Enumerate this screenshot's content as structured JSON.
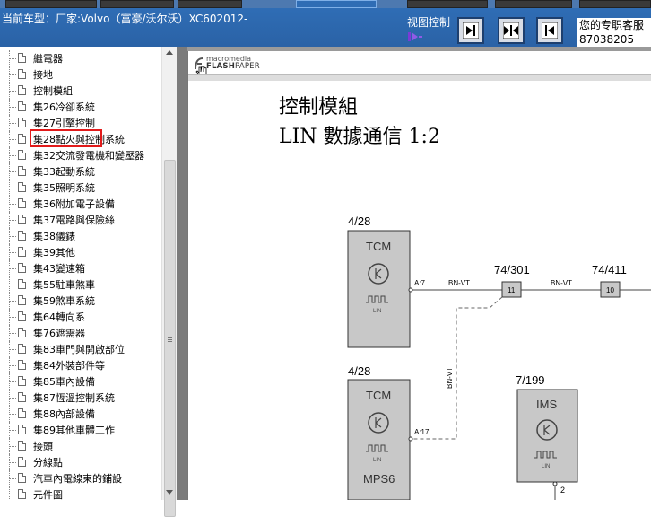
{
  "header": {
    "car_model": "当前车型：厂家:Volvo（富豪/沃尔沃）XC602012-",
    "view_control_label": "视图控制",
    "contact_line1": "您的专职客服",
    "contact_line2": "87038205",
    "controls": [
      "collapse-left-icon",
      "split-view-icon",
      "expand-left-icon"
    ]
  },
  "sidebar": {
    "items": [
      {
        "label": "繼電器"
      },
      {
        "label": "接地"
      },
      {
        "label": "控制模組",
        "selected": true
      },
      {
        "label": "集26冷卻系統"
      },
      {
        "label": "集27引擎控制"
      },
      {
        "label": "集28點火與控制系統"
      },
      {
        "label": "集32交流發電機和變壓器"
      },
      {
        "label": "集33起動系統"
      },
      {
        "label": "集35照明系統"
      },
      {
        "label": "集36附加電子設備"
      },
      {
        "label": "集37電路與保險絲"
      },
      {
        "label": "集38儀錶"
      },
      {
        "label": "集39其他"
      },
      {
        "label": "集43變速箱"
      },
      {
        "label": "集55駐車煞車"
      },
      {
        "label": "集59煞車系統"
      },
      {
        "label": "集64轉向系"
      },
      {
        "label": "集76遮需器"
      },
      {
        "label": "集83車門與開啟部位"
      },
      {
        "label": "集84外裝部件等"
      },
      {
        "label": "集85車內設備"
      },
      {
        "label": "集87恆溫控制系統"
      },
      {
        "label": "集88內部設備"
      },
      {
        "label": "集89其他車體工作"
      },
      {
        "label": "接頭"
      },
      {
        "label": "分線點"
      },
      {
        "label": "汽車內電線束的鋪設"
      },
      {
        "label": "元件圖"
      }
    ]
  },
  "viewer": {
    "logo_top": "macromedia",
    "logo_flash": "FLASH",
    "logo_paper": "PAPER",
    "title": "控制模組",
    "subtitle": "LIN 數據通信 1:2",
    "tcm1_ref": "4/28",
    "tcm1_name": "TCM",
    "tcm1_lin": "LIN",
    "tcm1_pin": "A:7",
    "wire1": "BN-VT",
    "conn1_ref": "74/301",
    "conn1_pin": "11",
    "wire2": "BN-VT",
    "conn2_ref": "74/411",
    "conn2_pin": "10",
    "wire_vertical": "BN-VT",
    "tcm2_ref": "4/28",
    "tcm2_name": "TCM",
    "tcm2_lin": "LIN",
    "tcm2_variant": "MPS6",
    "tcm2_pin": "A:17",
    "ims_ref": "7/199",
    "ims_name": "IMS",
    "ims_lin": "LIN",
    "ims_pin": "2"
  },
  "colors": {
    "header_bg": "#2f6db5",
    "highlight": "#e21b1b",
    "module_fill": "#c8c8c8"
  }
}
